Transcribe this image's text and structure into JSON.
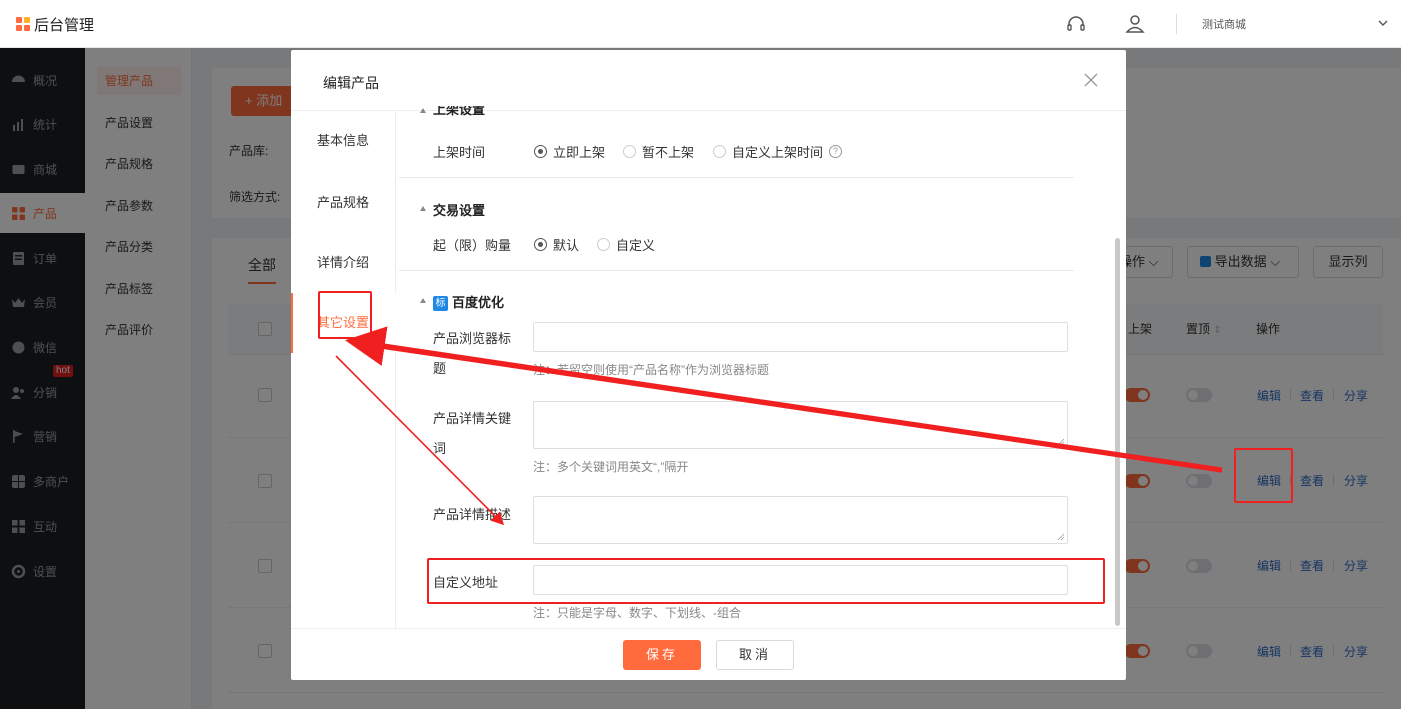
{
  "header": {
    "app_title": "后台管理",
    "shop_name": "测试商城",
    "logo_colors": [
      "#ff6b3d",
      "#ffb020",
      "#ff6b3d",
      "#ff6b3d"
    ]
  },
  "sidenav": {
    "items": [
      {
        "label": "概况",
        "icon": "dashboard-icon"
      },
      {
        "label": "统计",
        "icon": "stats-icon"
      },
      {
        "label": "商城",
        "icon": "store-icon"
      },
      {
        "label": "产品",
        "icon": "product-icon",
        "active": true
      },
      {
        "label": "订单",
        "icon": "order-icon"
      },
      {
        "label": "会员",
        "icon": "member-icon"
      },
      {
        "label": "微信",
        "icon": "wechat-icon"
      },
      {
        "label": "分销",
        "icon": "distribution-icon"
      },
      {
        "label": "营销",
        "icon": "marketing-icon",
        "badge": "hot"
      },
      {
        "label": "多商户",
        "icon": "merchant-icon"
      },
      {
        "label": "互动",
        "icon": "interaction-icon"
      },
      {
        "label": "设置",
        "icon": "settings-icon"
      }
    ]
  },
  "subnav": {
    "items": [
      "管理产品",
      "产品设置",
      "产品规格",
      "产品参数",
      "产品分类",
      "产品标签",
      "产品评价"
    ]
  },
  "main": {
    "add_button": "+ 添加",
    "product_lib_label": "产品库:",
    "filter_label": "筛选方式:",
    "tab_all": "全部",
    "batch_button": "操作",
    "export_button": "导出数据",
    "columns_button": "显示列",
    "headers": {
      "on_shelf": "上架",
      "pin_top": "置顶",
      "actions": "操作"
    },
    "row_actions": {
      "edit": "编辑",
      "view": "查看",
      "share": "分享"
    }
  },
  "modal": {
    "title": "编辑产品",
    "nav": [
      "基本信息",
      "产品规格",
      "详情介绍",
      "其它设置"
    ],
    "shelf_section": "上架设置",
    "shelf_time_label": "上架时间",
    "shelf_options": [
      "立即上架",
      "暂不上架",
      "自定义上架时间"
    ],
    "trade_section": "交易设置",
    "min_buy_label": "起（限）购量",
    "min_buy_options": [
      "默认",
      "自定义"
    ],
    "seo_badge": "标",
    "seo_section": "百度优化",
    "browser_title_label_1": "产品浏览器标",
    "browser_title_label_2": "题",
    "browser_title_note": "注：若留空则使用“产品名称”作为浏览器标题",
    "keywords_label_1": "产品详情关键",
    "keywords_label_2": "词",
    "keywords_note": "注：多个关键词用英文“,”隔开",
    "desc_label": "产品详情描述",
    "custom_url_label": "自定义地址",
    "custom_url_note": "注：只能是字母、数字、下划线、-组合",
    "save_button": "保存",
    "cancel_button": "取消"
  },
  "colors": {
    "accent": "#ff6b3d",
    "annotation": "#f12020",
    "link": "#2d6ac6"
  }
}
